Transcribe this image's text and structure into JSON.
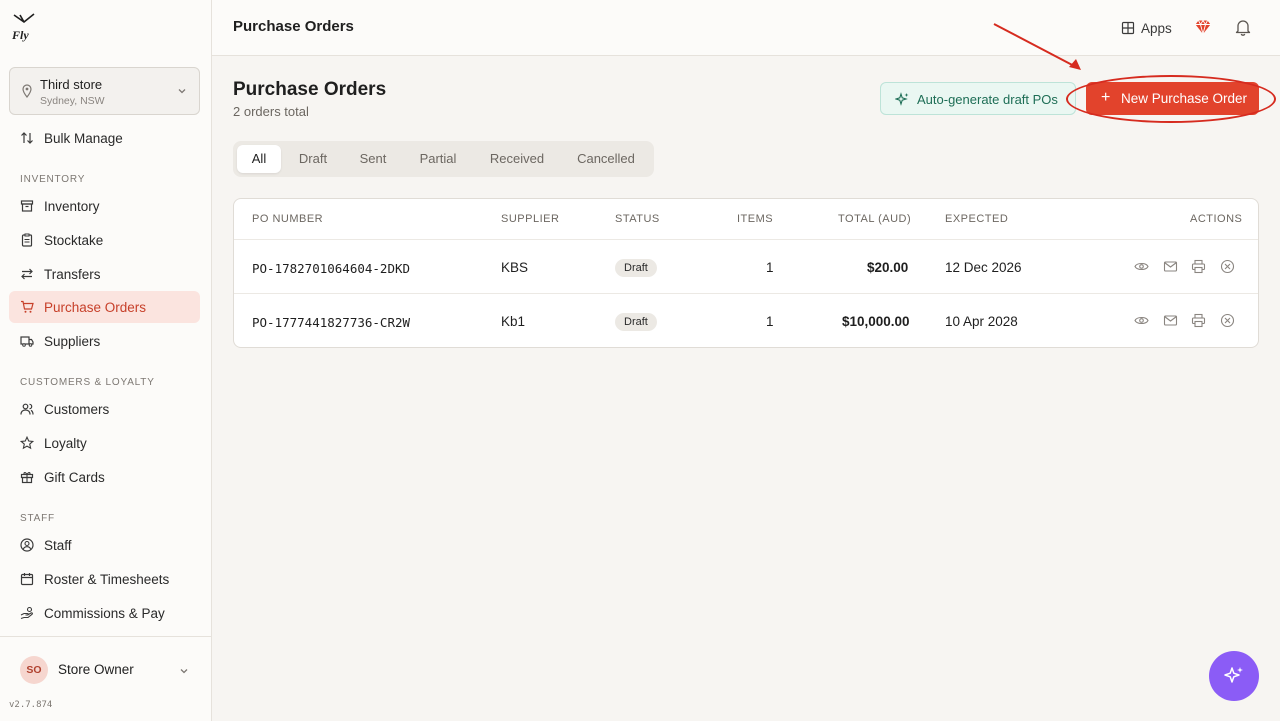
{
  "logo": {
    "text": "Fly"
  },
  "store": {
    "name": "Third store",
    "location": "Sydney, NSW"
  },
  "sidebar": {
    "top_items": [
      {
        "label": "Bulk Manage",
        "icon": "sort-arrows-icon"
      }
    ],
    "sections": [
      {
        "title": "INVENTORY",
        "items": [
          {
            "label": "Inventory",
            "icon": "box-icon"
          },
          {
            "label": "Stocktake",
            "icon": "clipboard-icon"
          },
          {
            "label": "Transfers",
            "icon": "transfer-arrows-icon"
          },
          {
            "label": "Purchase Orders",
            "icon": "cart-icon",
            "active": true
          },
          {
            "label": "Suppliers",
            "icon": "truck-icon"
          }
        ]
      },
      {
        "title": "CUSTOMERS & LOYALTY",
        "items": [
          {
            "label": "Customers",
            "icon": "users-icon"
          },
          {
            "label": "Loyalty",
            "icon": "star-icon"
          },
          {
            "label": "Gift Cards",
            "icon": "gift-icon"
          }
        ]
      },
      {
        "title": "STAFF",
        "items": [
          {
            "label": "Staff",
            "icon": "user-circle-icon"
          },
          {
            "label": "Roster & Timesheets",
            "icon": "calendar-icon"
          },
          {
            "label": "Commissions & Pay",
            "icon": "hand-coins-icon"
          }
        ]
      }
    ]
  },
  "user": {
    "initials": "SO",
    "name": "Store Owner"
  },
  "version": "v2.7.874",
  "header": {
    "title": "Purchase Orders",
    "apps_label": "Apps"
  },
  "main": {
    "title": "Purchase Orders",
    "subtitle": "2 orders total",
    "auto_generate_label": "Auto-generate draft POs",
    "new_po_label": "New Purchase Order",
    "tabs": [
      "All",
      "Draft",
      "Sent",
      "Partial",
      "Received",
      "Cancelled"
    ],
    "active_tab": "All",
    "columns": [
      "PO NUMBER",
      "SUPPLIER",
      "STATUS",
      "ITEMS",
      "TOTAL (AUD)",
      "EXPECTED",
      "ACTIONS"
    ],
    "rows": [
      {
        "po": "PO-1782701064604-2DKD",
        "supplier": "KBS",
        "status": "Draft",
        "items": "1",
        "total": "$20.00",
        "expected": "12 Dec 2026"
      },
      {
        "po": "PO-1777441827736-CR2W",
        "supplier": "Kb1",
        "status": "Draft",
        "items": "1",
        "total": "$10,000.00",
        "expected": "10 Apr 2028"
      }
    ]
  },
  "colors": {
    "accent": "#e2432c",
    "active_bg": "#fbe4df",
    "teal": "#1e6e56",
    "fab": "#8b5cf6",
    "annotation": "#d62b1f"
  }
}
